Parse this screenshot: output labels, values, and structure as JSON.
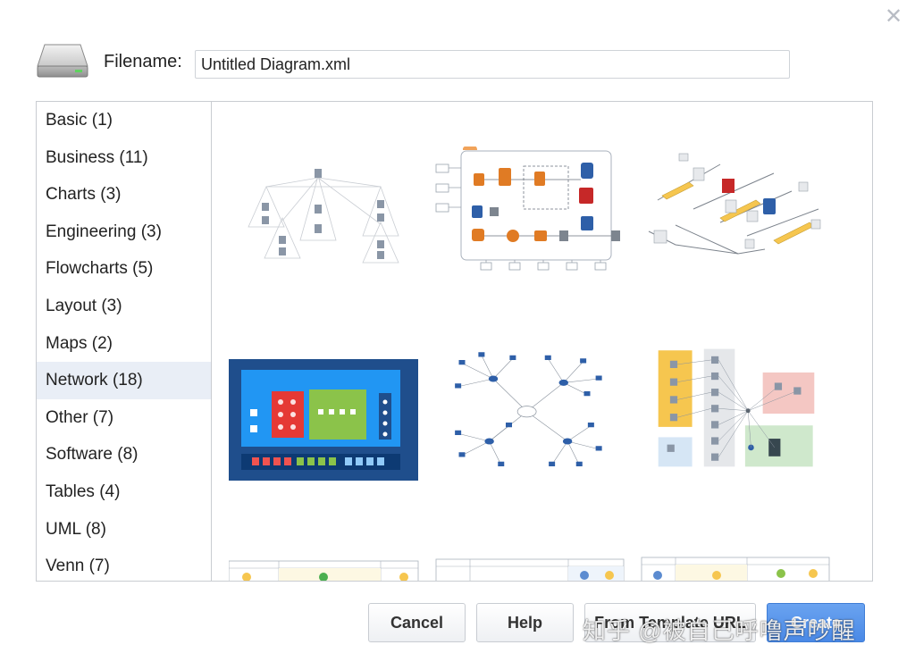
{
  "dialog": {
    "close_icon": "close-icon",
    "filename_label": "Filename:",
    "filename_value": "Untitled Diagram.xml"
  },
  "categories": [
    {
      "label": "Basic (1)",
      "selected": false
    },
    {
      "label": "Business (11)",
      "selected": false
    },
    {
      "label": "Charts (3)",
      "selected": false
    },
    {
      "label": "Engineering (3)",
      "selected": false
    },
    {
      "label": "Flowcharts (5)",
      "selected": false
    },
    {
      "label": "Layout (3)",
      "selected": false
    },
    {
      "label": "Maps (2)",
      "selected": false
    },
    {
      "label": "Network (18)",
      "selected": true
    },
    {
      "label": "Other (7)",
      "selected": false
    },
    {
      "label": "Software (8)",
      "selected": false
    },
    {
      "label": "Tables (4)",
      "selected": false
    },
    {
      "label": "UML (8)",
      "selected": false
    },
    {
      "label": "Venn (7)",
      "selected": false
    }
  ],
  "colors": {
    "selected_category_bg": "#e9eef6",
    "primary_button": "#4a89e6",
    "aws_orange": "#e07b24",
    "aws_blue": "#2e5fa8",
    "aws_red": "#c62828",
    "zone_yellow": "#f6c64f",
    "zone_red": "#f4c7c3",
    "zone_green": "#cfe8cc",
    "zone_blue": "#d6e6f5",
    "dark_panel": "#1f4e8c",
    "bright_blue": "#2196f3",
    "lime": "#8bc34a"
  },
  "buttons": {
    "cancel": "Cancel",
    "help": "Help",
    "from_template": "From Template URL",
    "create": "Create"
  },
  "watermark": "知乎 @被自己呼噜声吵醒"
}
